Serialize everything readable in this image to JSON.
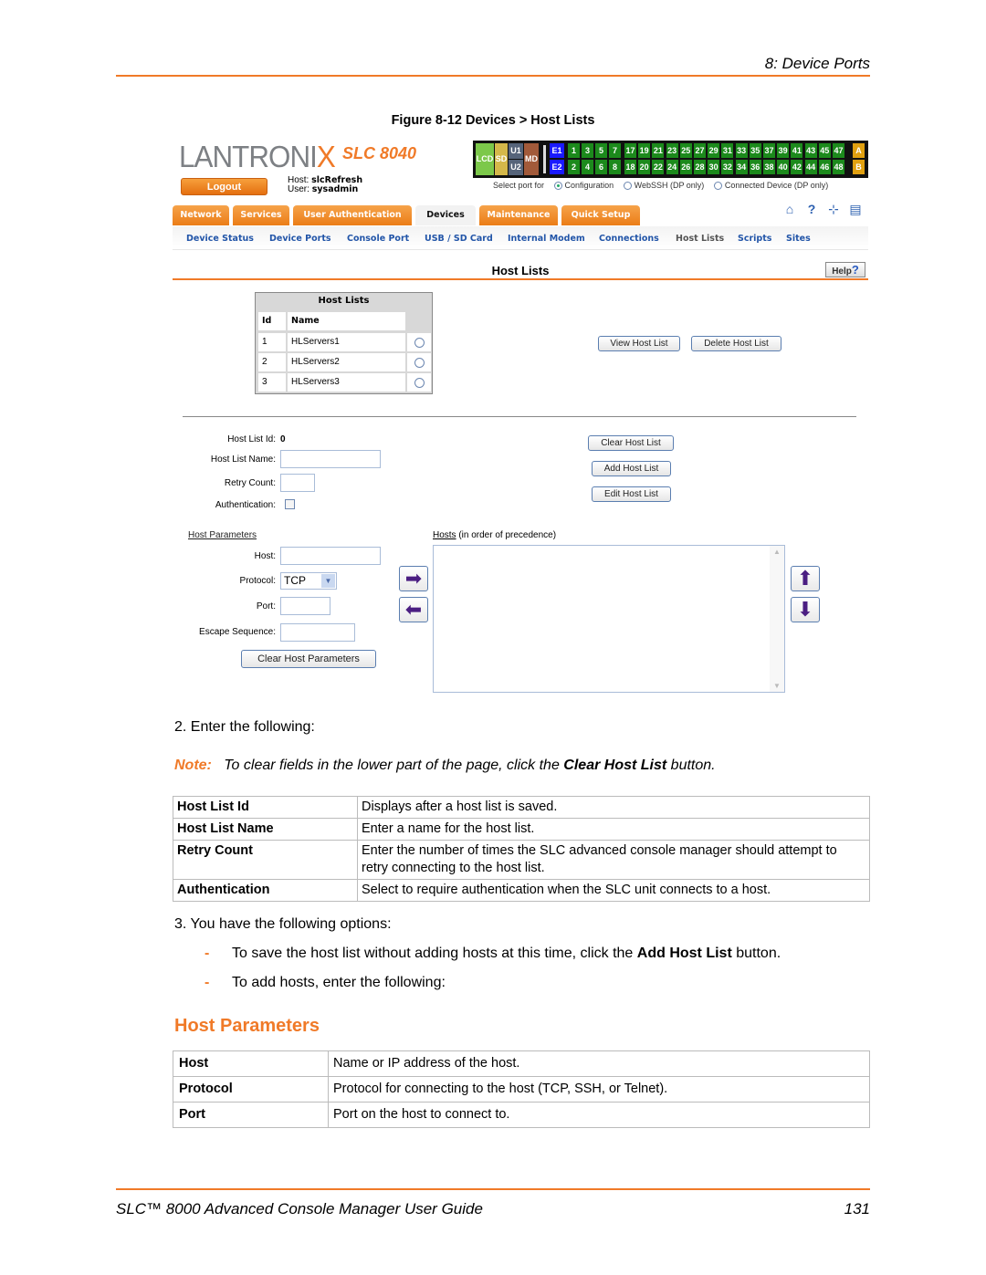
{
  "header": {
    "chapter": "8: Device Ports"
  },
  "figure": {
    "caption": "Figure 8-12  Devices > Host Lists"
  },
  "ui": {
    "logo": {
      "text_main": "LANTRONI",
      "text_x": "X",
      "model": "SLC 8040"
    },
    "logout_label": "Logout",
    "host_label": "Host:",
    "host_value": "slcRefresh",
    "user_label": "User:",
    "user_value": "sysadmin",
    "ports": {
      "left_blocks": [
        "LCD",
        "SD",
        "U1",
        "U2",
        "MD"
      ],
      "e_labels": [
        "E1",
        "E2"
      ],
      "top_row": [
        "1",
        "3",
        "5",
        "7",
        "17",
        "19",
        "21",
        "23",
        "25",
        "27",
        "29",
        "31",
        "33",
        "35",
        "37",
        "39",
        "41",
        "43",
        "45",
        "47"
      ],
      "bottom_row": [
        "2",
        "4",
        "6",
        "8",
        "18",
        "20",
        "22",
        "24",
        "26",
        "28",
        "30",
        "32",
        "34",
        "36",
        "38",
        "40",
        "42",
        "44",
        "46",
        "48"
      ],
      "ab": [
        "A",
        "B"
      ],
      "colors": {
        "lcd": "#7cc84a",
        "sd": "#d4b84a",
        "u": "#56647a",
        "md": "#a25a3a",
        "e": "#1a1aff",
        "port": "#1c8a1c",
        "ab": "#e0a010"
      }
    },
    "select_port": {
      "label": "Select port for",
      "options": [
        "Configuration",
        "WebSSH (DP only)",
        "Connected Device (DP only)"
      ],
      "selected": "Configuration"
    },
    "tabs": [
      "Network",
      "Services",
      "User Authentication",
      "Devices",
      "Maintenance",
      "Quick Setup"
    ],
    "active_tab": "Devices",
    "tool_icons": [
      "home-icon",
      "help-icon",
      "sitemap-icon",
      "log-icon"
    ],
    "subnav": [
      "Device Status",
      "Device Ports",
      "Console Port",
      "USB / SD Card",
      "Internal Modem",
      "Connections",
      "Host Lists",
      "Scripts",
      "Sites"
    ],
    "active_subnav": "Host Lists",
    "page_title": "Host Lists",
    "help_label": "Help",
    "host_lists_table": {
      "title": "Host Lists",
      "columns": [
        "Id",
        "Name"
      ],
      "rows": [
        {
          "id": "1",
          "name": "HLServers1"
        },
        {
          "id": "2",
          "name": "HLServers2"
        },
        {
          "id": "3",
          "name": "HLServers3"
        }
      ]
    },
    "view_btn": "View Host List",
    "delete_btn": "Delete Host List",
    "form": {
      "host_list_id_label": "Host List Id:",
      "host_list_id_value": "0",
      "host_list_name_label": "Host List Name:",
      "host_list_name_value": "",
      "retry_count_label": "Retry Count:",
      "retry_count_value": "",
      "authentication_label": "Authentication:",
      "authentication_checked": false
    },
    "clear_host_list_btn": "Clear Host List",
    "add_host_list_btn": "Add Host List",
    "edit_host_list_btn": "Edit Host List",
    "host_params_link": "Host Parameters",
    "hosts_link": "Hosts",
    "hosts_suffix": " (in order of precedence)",
    "params": {
      "host_label": "Host:",
      "host_value": "",
      "protocol_label": "Protocol:",
      "protocol_value": "TCP",
      "port_label": "Port:",
      "port_value": "",
      "escape_label": "Escape Sequence:",
      "escape_value": ""
    },
    "clear_params_btn": "Clear Host Parameters",
    "hosts_list": []
  },
  "doc": {
    "step2": "2.   Enter the following:",
    "note_label": "Note:",
    "note_text_pre": "To clear fields in the lower part of the page, click the ",
    "note_bold": "Clear Host List",
    "note_text_post": " button.",
    "table1": [
      {
        "key": "Host List Id",
        "value": "Displays after a host list is saved."
      },
      {
        "key": "Host List Name",
        "value": "Enter a name for the host list."
      },
      {
        "key": "Retry Count",
        "value": "Enter the number of times the SLC advanced console manager should attempt to retry connecting to the host list."
      },
      {
        "key": "Authentication",
        "value": "Select to require authentication when the SLC unit connects to a host."
      }
    ],
    "step3": "3.   You have the following options:",
    "bullet1_pre": "To save the host list without adding hosts at this time, click the ",
    "bullet1_bold": "Add Host List",
    "bullet1_post": " button.",
    "bullet2": "To add hosts, enter the following:",
    "bullet_char": "-",
    "section_title": "Host Parameters",
    "table2": [
      {
        "key": "Host",
        "value": "Name or IP address of the host."
      },
      {
        "key": "Protocol",
        "value": "Protocol for connecting to the host (TCP, SSH, or Telnet)."
      },
      {
        "key": "Port",
        "value": "Port on the host to connect to."
      }
    ]
  },
  "footer": {
    "title": "SLC™ 8000 Advanced Console Manager User Guide",
    "page": "131"
  }
}
